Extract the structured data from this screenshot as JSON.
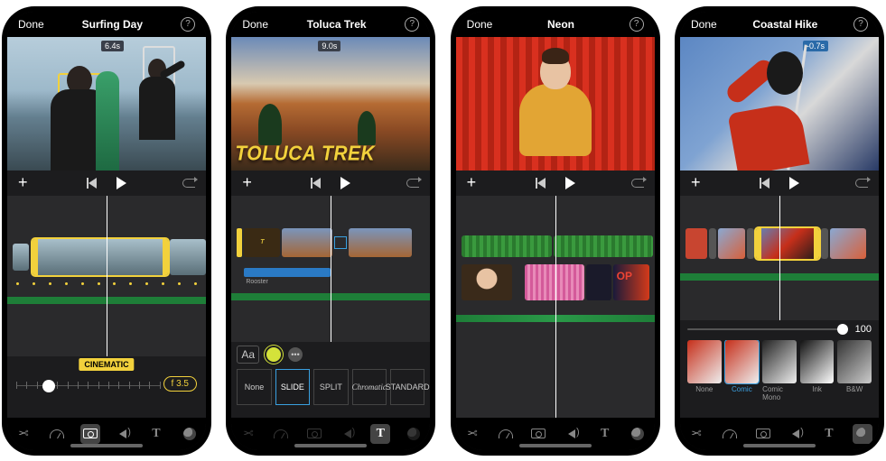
{
  "screens": [
    {
      "done": "Done",
      "title": "Surfing Day",
      "badge": "6.4s",
      "cinematic_label": "CINEMATIC",
      "fstop": "f 3.5"
    },
    {
      "done": "Done",
      "title": "Toluca Trek",
      "badge": "9.0s",
      "overlay_title": "TOLUCA TREK",
      "audio_label": "Rooster",
      "text_button": "Aa",
      "transitions": [
        "None",
        "SLIDE",
        "SPLIT",
        "Chromatic",
        "STANDARD"
      ],
      "selected_transition": "SLIDE"
    },
    {
      "done": "Done",
      "title": "Neon"
    },
    {
      "done": "Done",
      "title": "Coastal Hike",
      "badge": "-0.7s",
      "filter_value": "100",
      "filters": [
        "None",
        "Comic",
        "Comic Mono",
        "Ink",
        "B&W"
      ],
      "selected_filter": "Comic"
    }
  ],
  "tools": [
    "scissors",
    "speed",
    "camera",
    "audio",
    "text",
    "effects"
  ]
}
